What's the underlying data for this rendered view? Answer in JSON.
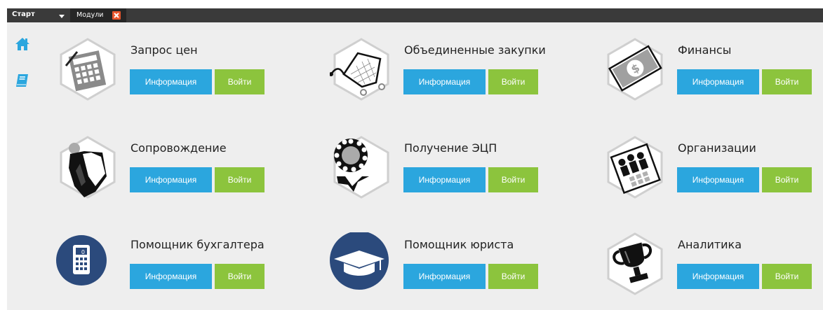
{
  "topbar": {
    "start_label": "Старт",
    "tab_label": "Модули",
    "colors": {
      "strip": "#3a3a3a",
      "close": "#e8552c"
    }
  },
  "sidebar": {
    "items": [
      {
        "icon": "home-icon"
      },
      {
        "icon": "book-icon"
      }
    ],
    "accent": "#2ba6de"
  },
  "buttons": {
    "info_color": "#2ba6de",
    "enter_color": "#8cc43d"
  },
  "modules": [
    {
      "title": "Запрос цен",
      "info_label": "Информация",
      "enter_label": "Войти",
      "icon": "calculator-icon"
    },
    {
      "title": "Объединенные закупки",
      "info_label": "Информация",
      "enter_label": "Войти",
      "icon": "cart-icon"
    },
    {
      "title": "Финансы",
      "info_label": "Информация",
      "enter_label": "Войти",
      "icon": "money-icon"
    },
    {
      "title": "Сопровождение",
      "info_label": "Информация",
      "enter_label": "Войти",
      "icon": "person-icon"
    },
    {
      "title": "Получение ЭЦП",
      "info_label": "Информация",
      "enter_label": "Войти",
      "icon": "seal-icon"
    },
    {
      "title": "Организации",
      "info_label": "Информация",
      "enter_label": "Войти",
      "icon": "organization-icon"
    },
    {
      "title": "Помощник бухгалтера",
      "info_label": "Информация",
      "enter_label": "Войти",
      "icon": "accountant-calculator-icon"
    },
    {
      "title": "Помощник юриста",
      "info_label": "Информация",
      "enter_label": "Войти",
      "icon": "graduation-cap-icon"
    },
    {
      "title": "Аналитика",
      "info_label": "Информация",
      "enter_label": "Войти",
      "icon": "trophy-icon"
    }
  ]
}
